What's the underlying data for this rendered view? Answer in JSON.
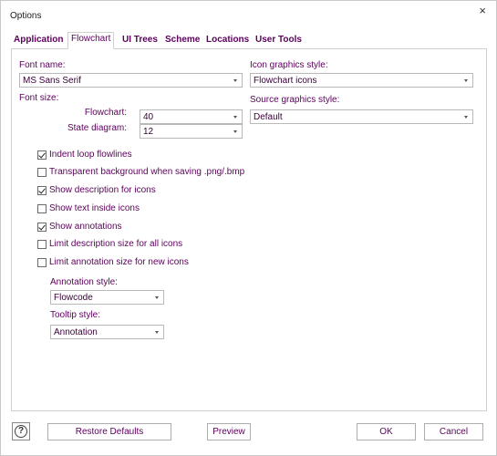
{
  "window": {
    "title": "Options",
    "close_glyph": "×"
  },
  "tabs": [
    {
      "label": "Application",
      "active": false
    },
    {
      "label": "Flowchart",
      "active": true
    },
    {
      "label": "UI Trees",
      "active": false
    },
    {
      "label": "Scheme",
      "active": false
    },
    {
      "label": "Locations",
      "active": false
    },
    {
      "label": "User Tools",
      "active": false
    }
  ],
  "fields": {
    "font_name_label": "Font name:",
    "font_name_value": "MS Sans Serif",
    "font_size_label": "Font size:",
    "flowchart_label": "Flowchart:",
    "flowchart_value": "40",
    "state_diagram_label": "State diagram:",
    "state_diagram_value": "12",
    "icon_graphics_label": "Icon graphics style:",
    "icon_graphics_value": "Flowchart icons",
    "source_graphics_label": "Source graphics style:",
    "source_graphics_value": "Default",
    "annotation_style_label": "Annotation style:",
    "annotation_style_value": "Flowcode",
    "tooltip_style_label": "Tooltip style:",
    "tooltip_style_value": "Annotation"
  },
  "checkboxes": [
    {
      "label": "Indent loop flowlines",
      "checked": true
    },
    {
      "label": "Transparent background when saving .png/.bmp",
      "checked": false
    },
    {
      "label": "Show description for icons",
      "checked": true
    },
    {
      "label": "Show text inside icons",
      "checked": false
    },
    {
      "label": "Show annotations",
      "checked": true
    },
    {
      "label": "Limit description size for all icons",
      "checked": false
    },
    {
      "label": "Limit annotation size for new icons",
      "checked": false
    }
  ],
  "buttons": {
    "restore_defaults": "Restore Defaults",
    "preview": "Preview",
    "ok": "OK",
    "cancel": "Cancel",
    "help_glyph": "?"
  },
  "colors": {
    "text": "#5c005c",
    "border": "#d0d0d0"
  }
}
